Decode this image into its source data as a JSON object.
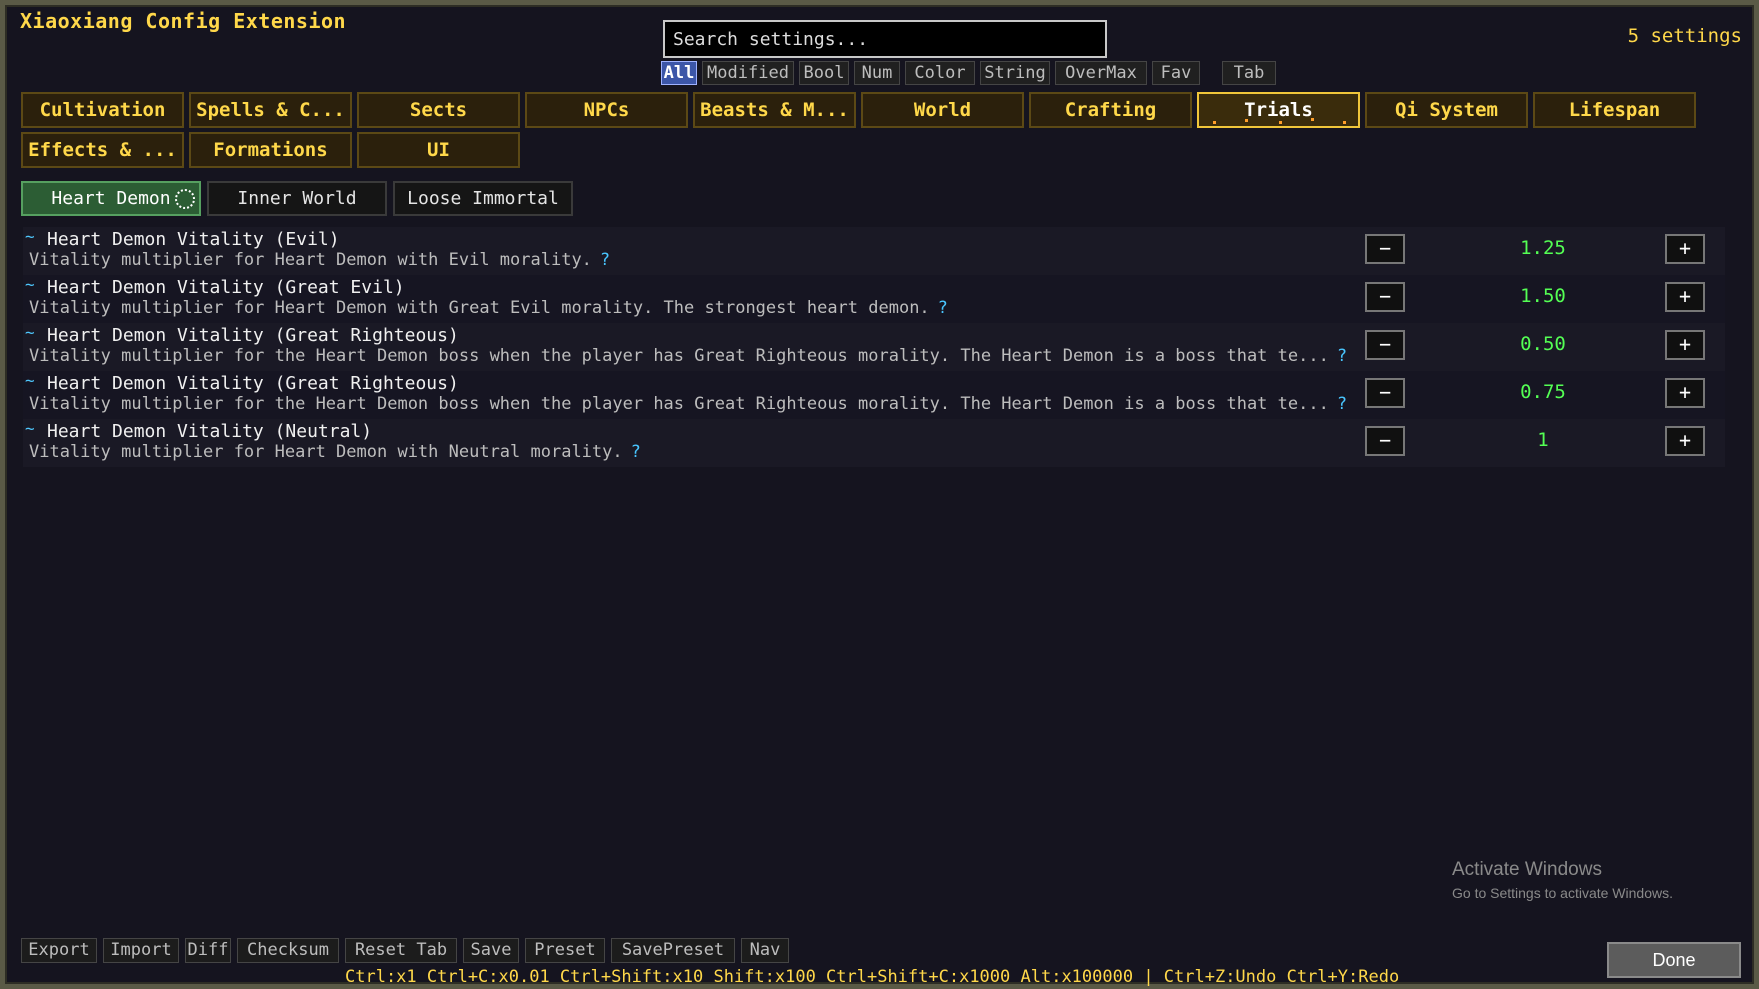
{
  "window": {
    "title": "Xiaoxiang Config Extension",
    "count": "5 settings"
  },
  "search": {
    "placeholder": "Search settings..."
  },
  "filters": [
    "All",
    "Modified",
    "Bool",
    "Num",
    "Color",
    "String",
    "OverMax",
    "Fav",
    "Tab"
  ],
  "active_filter": "All",
  "categories": [
    "Cultivation",
    "Spells & C...",
    "Sects",
    "NPCs",
    "Beasts & M...",
    "World",
    "Crafting",
    "Trials",
    "Qi System",
    "Lifespan",
    "Effects & ...",
    "Formations",
    "UI"
  ],
  "active_category": "Trials",
  "subtabs": [
    "Heart Demon",
    "Inner World",
    "Loose Immortal"
  ],
  "active_subtab": "Heart Demon",
  "settings": [
    {
      "name": "Heart Demon Vitality (Evil)",
      "desc": "Vitality multiplier for Heart Demon with Evil morality.",
      "value": "1.25"
    },
    {
      "name": "Heart Demon Vitality (Great Evil)",
      "desc": "Vitality multiplier for Heart Demon with Great Evil morality. The strongest heart demon.",
      "value": "1.50"
    },
    {
      "name": "Heart Demon Vitality (Great Righteous)",
      "desc": "Vitality multiplier for the Heart Demon boss when the player has Great Righteous morality. The Heart Demon is a boss that te...",
      "value": "0.50"
    },
    {
      "name": "Heart Demon Vitality (Great Righteous)",
      "desc": "Vitality multiplier for the Heart Demon boss when the player has Great Righteous morality. The Heart Demon is a boss that te...",
      "value": "0.75"
    },
    {
      "name": "Heart Demon Vitality (Neutral)",
      "desc": "Vitality multiplier for Heart Demon with Neutral morality.",
      "value": "1"
    }
  ],
  "controls": {
    "modified_marker": "~",
    "help": "?",
    "minus": "−",
    "plus": "+"
  },
  "actions": [
    "Export",
    "Import",
    "Diff",
    "Checksum",
    "Reset Tab",
    "Save",
    "Preset",
    "SavePreset",
    "Nav"
  ],
  "hints": "Ctrl:x1  Ctrl+C:x0.01  Ctrl+Shift:x10  Shift:x100  Ctrl+Shift+C:x1000  Alt:x100000  |  Ctrl+Z:Undo  Ctrl+Y:Redo",
  "done_label": "Done",
  "watermark": {
    "title": "Activate Windows",
    "subtitle": "Go to Settings to activate Windows."
  },
  "colors": {
    "accent_gold": "#ffd84a",
    "value_green": "#54ff54",
    "help_cyan": "#49c6ff",
    "active_filter": "#3c56a8",
    "active_subtab": "#2c5d34"
  }
}
